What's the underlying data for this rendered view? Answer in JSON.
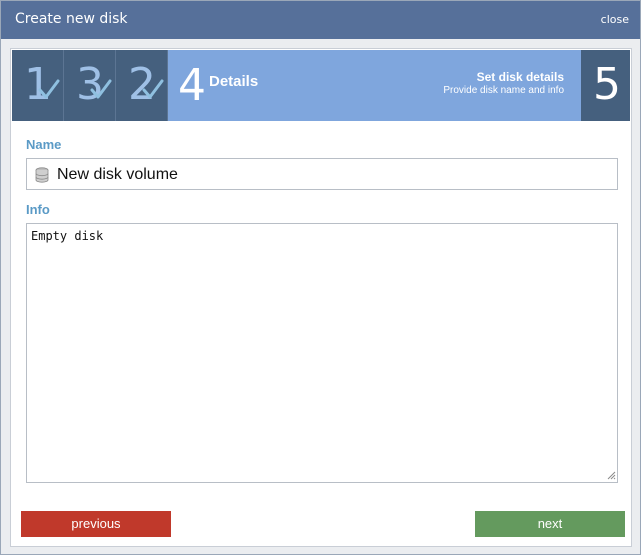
{
  "window": {
    "title": "Create new disk",
    "close_label": "close"
  },
  "steps": {
    "completed": [
      "1",
      "3",
      "2"
    ],
    "current": {
      "number": "4",
      "label": "Details"
    },
    "info": {
      "title": "Set disk details",
      "subtitle": "Provide disk name and info"
    },
    "next": "5"
  },
  "form": {
    "name_label": "Name",
    "name_value": "New disk volume",
    "info_label": "Info",
    "info_value": "Empty disk"
  },
  "buttons": {
    "previous": "previous",
    "next": "next"
  },
  "colors": {
    "titlebar": "#56709a",
    "step_active": "#7fa6dd",
    "step_done": "#45607e",
    "label": "#5a9ac6",
    "previous": "#c0392b",
    "next": "#649a5e"
  },
  "icons": {
    "step_done": "checkmark-icon",
    "name_field": "disk-stack-icon"
  }
}
